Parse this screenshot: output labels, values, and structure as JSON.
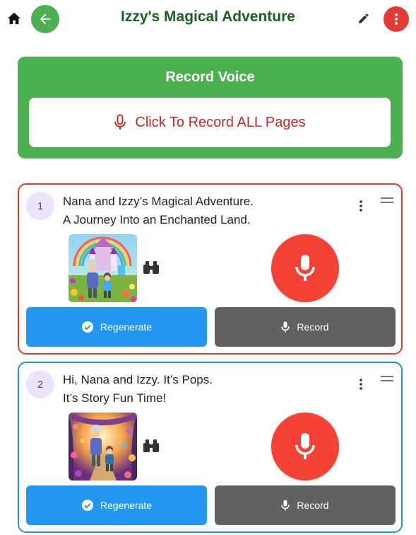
{
  "header": {
    "title": "Izzy's Magical Adventure",
    "icons": [
      "home-icon",
      "arrow-back-icon",
      "pencil-icon",
      "more-vertical-icon"
    ]
  },
  "record_panel": {
    "title": "Record Voice",
    "button_label": "Click To Record ALL Pages"
  },
  "pages": [
    {
      "number": "1",
      "line1": "Nana and Izzy’s Magical Adventure.",
      "line2": "A Journey Into an Enchanted Land.",
      "regenerate_label": "Regenerate",
      "record_label": "Record",
      "border_color": "#e53935"
    },
    {
      "number": "2",
      "line1": "Hi, Nana and Izzy. It’s Pops.",
      "line2": "It’s Story Fun Time!",
      "regenerate_label": "Regenerate",
      "record_label": "Record",
      "border_color": "#2a8fd0"
    }
  ],
  "colors": {
    "brand_green": "#4caf50",
    "title_green": "#1b5e20",
    "record_red": "#f44336",
    "regenerate_blue": "#2196f3",
    "record_gray": "#616161"
  }
}
